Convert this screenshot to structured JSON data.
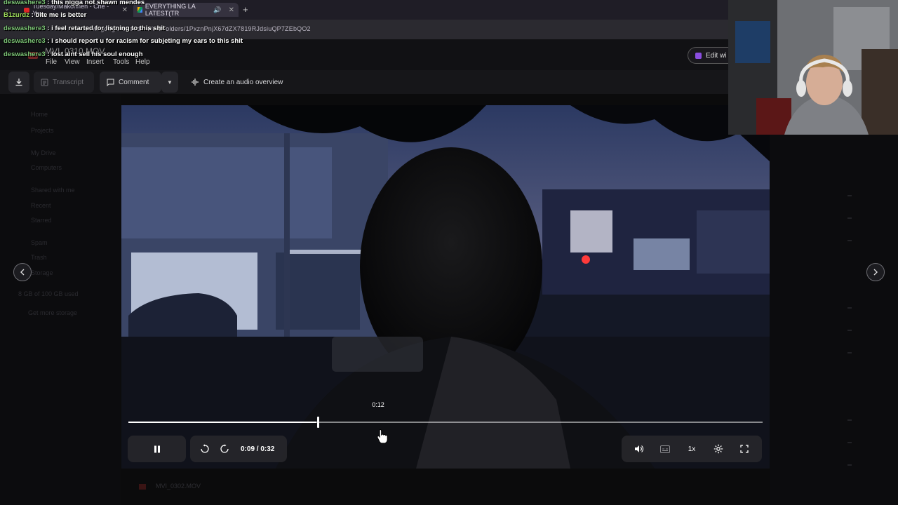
{
  "browser": {
    "tabs": [
      {
        "label": "Tuesday/Makonnen - Che - You",
        "active": false
      },
      {
        "label": "EVERYTHING LA LATEST(TR",
        "active": true,
        "audio": true
      }
    ],
    "url": "drive.google.com/drive/u/2/folders/1PxznPnjX67dZX7819RJdsiuQP7ZEbQO2"
  },
  "app": {
    "file_title": "MVI_0310.MOV",
    "menu": [
      "File",
      "View",
      "Insert",
      "Tools",
      "Help"
    ],
    "edit_button": "Edit wi",
    "toolbar": {
      "transcript": "Transcript",
      "comment": "Comment",
      "audio_overview": "Create an audio overview"
    }
  },
  "sidebar": {
    "items": [
      "Home",
      "Projects",
      "My Drive",
      "Computers",
      "Shared with me",
      "Recent",
      "Starred",
      "Spam",
      "Trash",
      "Storage",
      "8 GB of 100 GB used",
      "Get more storage"
    ]
  },
  "player": {
    "scrub_preview_time": "0:12",
    "time_display": "0:09 / 0:32",
    "progress": 0.296,
    "speed": "1x",
    "state": "playing"
  },
  "bottom_row": {
    "filename": "MVI_0302.MOV"
  },
  "chat": [
    {
      "user": "deswashere3",
      "message": "this nigga not shawn mendes"
    },
    {
      "user": "B1zurdz",
      "message": "bite me is better"
    },
    {
      "user": "deswashere3",
      "message": "i feel retarted for listning to this shit"
    },
    {
      "user": "deswashere3",
      "message": "i should report u for racism for subjeting my ears to this shit"
    },
    {
      "user": "deswashere3",
      "message": "lost aint sell his soul enough"
    }
  ],
  "colors": {
    "chat_user": "#7cc576",
    "chat_user_alt": "#9bd85a",
    "accent": "#8a4de0"
  }
}
